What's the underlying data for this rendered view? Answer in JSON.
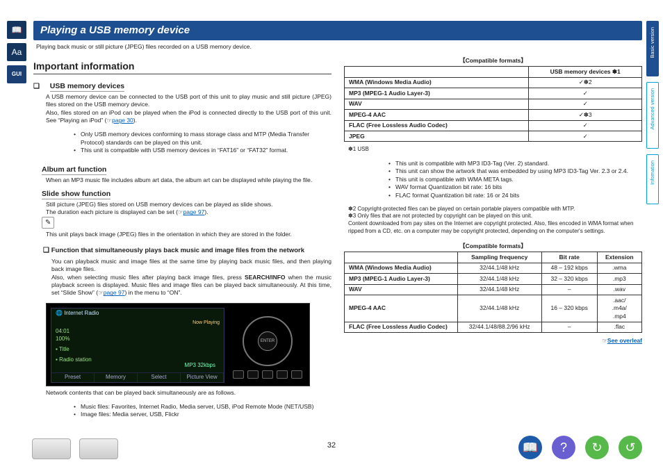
{
  "page_number": "32",
  "rail": {
    "book": "📖",
    "aa": "Aa",
    "gui": "GUI"
  },
  "tabs": {
    "basic": "Basic version",
    "advanced": "Advanced version",
    "info": "Infomation"
  },
  "title": "Playing a USB memory device",
  "subtitle": "Playing back music or still picture (JPEG) files recorded on a USB memory device.",
  "h_important": "Important information",
  "sec_usb": {
    "heading": "USB memory devices",
    "p1": "A USB memory device can be connected to the USB port of this unit to play music and still picture (JPEG) files stored on the USB memory device.",
    "p2a": "Also, files stored on an iPod can be played when the iPod is connected directly to the USB port of this unit. See “Playing an iPod” (",
    "p2link": "page 30",
    "p2b": ").",
    "b1": "Only USB memory devices conforming to mass storage class and MTP (Media Transfer Protocol) standards can be played on this unit.",
    "b2": "This unit is compatible with USB memory devices in “FAT16” or “FAT32” format."
  },
  "sec_album": {
    "heading": "Album art function",
    "p": "When an MP3 music file includes album art data, the album art can be displayed while playing the file."
  },
  "sec_slide": {
    "heading": "Slide show function",
    "p1": "Still picture (JPEG) files stored on USB memory devices can be played as slide shows.",
    "p2a": "The duration each picture is displayed can be set (",
    "p2link": "page 97",
    "p2b": ")."
  },
  "pencil_note": "This unit plays back image (JPEG) files in the orientation in which they are stored in the folder.",
  "sec_func": {
    "heading": "Function that simultaneously plays back music and image files from the network",
    "p1": "You can playback music and image files at the same time by playing back music files, and then playing back image files.",
    "p2a": "Also, when selecting music files after playing back image files, press ",
    "p2key": "SEARCH/INFO",
    "p2b": " when the music playback screen is displayed. Music files and image files can be played back simultaneously. At this time, set “Slide Show” (",
    "p2link": "page 97",
    "p2c": ") in the menu to “ON”."
  },
  "player": {
    "header": "Internet Radio",
    "now_playing": "Now Playing",
    "rows": [
      "Title",
      "Radio station"
    ],
    "meta_left": "04:01\n100%",
    "meta_right": "MP3 32kbps",
    "foot": [
      "Preset",
      "Memory",
      "Select",
      "Picture View"
    ],
    "enter": "ENTER"
  },
  "after_player": {
    "p": "Network contents that can be played back simultaneously are as follows.",
    "b1": "Music files: Favorites, Internet Radio, Media server, USB, iPod Remote Mode (NET/USB)",
    "b2": "Image files: Media server, USB, Flickr"
  },
  "tbl1": {
    "caption": "【Compatible formats】",
    "col2": "USB memory devices ✽1",
    "rows": [
      {
        "a": "WMA (Windows Media Audio)",
        "b": "✓✽2"
      },
      {
        "a": "MP3 (MPEG-1 Audio Layer-3)",
        "b": "✓"
      },
      {
        "a": "WAV",
        "b": "✓"
      },
      {
        "a": "MPEG-4 AAC",
        "b": "✓✽3"
      },
      {
        "a": "FLAC (Free Lossless Audio Codec)",
        "b": "✓"
      },
      {
        "a": "JPEG",
        "b": "✓"
      }
    ]
  },
  "notes": {
    "n1_lead": "✽1  USB",
    "n1": [
      "This unit is compatible with MP3 ID3-Tag (Ver. 2) standard.",
      "This unit can show the artwork that was embedded by using MP3 ID3-Tag Ver. 2.3 or 2.4.",
      "This unit is compatible with WMA META tags.",
      "WAV format Quantization bit rate: 16 bits",
      "FLAC format Quantization bit rate: 16 or 24 bits"
    ],
    "n2": "✽2  Copyright-protected files can be played on certain portable players compatible with MTP.",
    "n3": "✽3  Only files that are not protected by copyright can be played on this unit.\nContent downloaded from pay sites on the Internet are copyright protected. Also, files encoded in WMA format when ripped from a CD, etc. on a computer may be copyright protected, depending on the computer's settings."
  },
  "tbl2": {
    "caption": "【Compatible formats】",
    "head": [
      "",
      "Sampling frequency",
      "Bit rate",
      "Extension"
    ],
    "rows": [
      {
        "a": "WMA (Windows Media Audio)",
        "f": "32/44.1/48 kHz",
        "br": "48 – 192 kbps",
        "ext": ".wma"
      },
      {
        "a": "MP3 (MPEG-1 Audio Layer-3)",
        "f": "32/44.1/48 kHz",
        "br": "32 – 320 kbps",
        "ext": ".mp3"
      },
      {
        "a": "WAV",
        "f": "32/44.1/48 kHz",
        "br": "–",
        "ext": ".wav"
      },
      {
        "a": "MPEG-4 AAC",
        "f": "32/44.1/48 kHz",
        "br": "16 – 320 kbps",
        "ext": ".aac/\n.m4a/\n.mp4"
      },
      {
        "a": "FLAC (Free Lossless Audio Codec)",
        "f": "32/44.1/48/88.2/96 kHz",
        "br": "–",
        "ext": ".flac"
      }
    ]
  },
  "overleaf": "See overleaf",
  "foot_icons": {
    "book": "📖",
    "help": "?",
    "back": "↻",
    "fwd": "↺"
  }
}
